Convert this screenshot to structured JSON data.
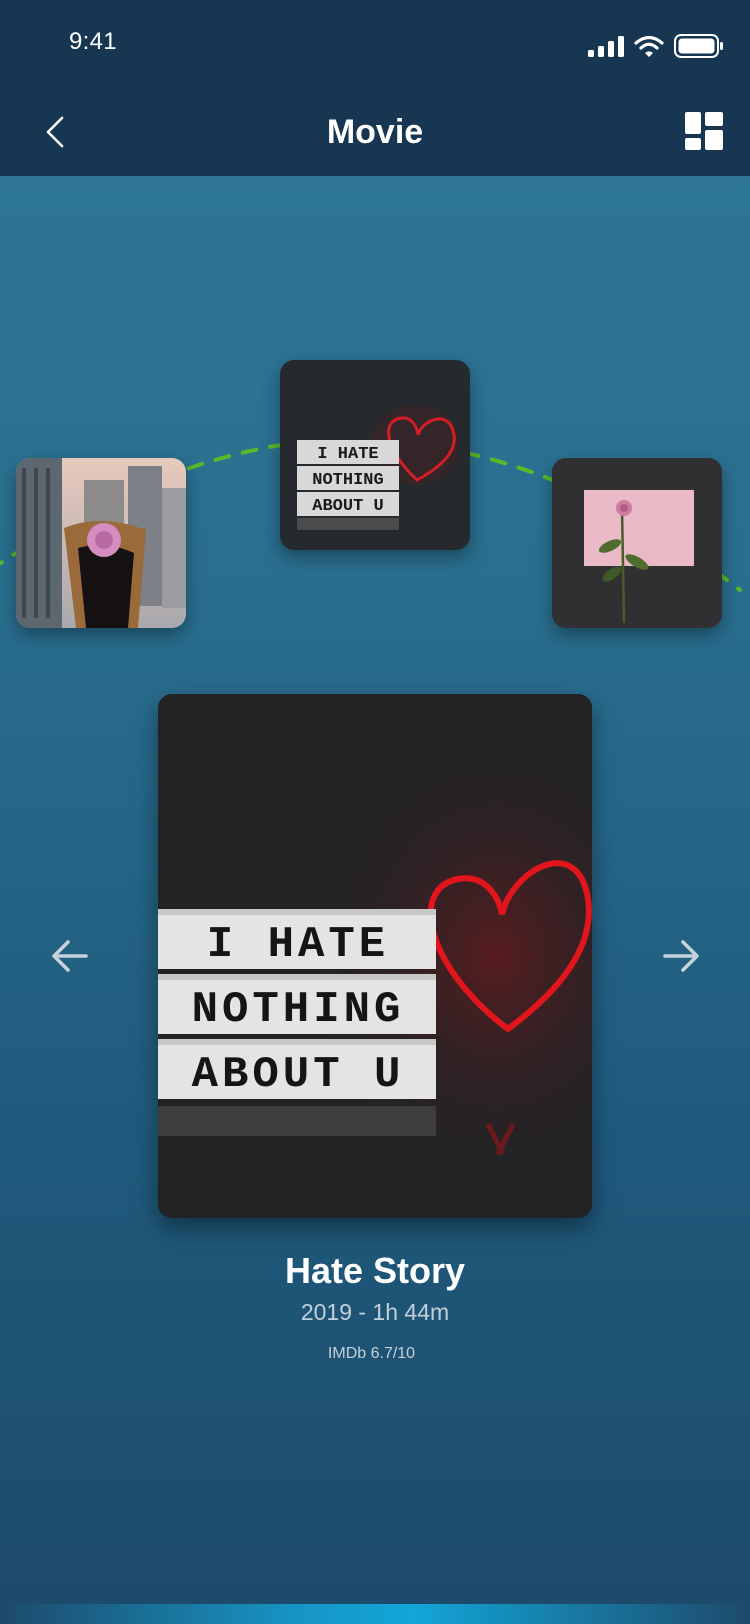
{
  "status_bar": {
    "time": "9:41"
  },
  "header": {
    "title": "Movie"
  },
  "carousel": {
    "items": [
      {
        "name": "rose-bouquet-cityscape"
      },
      {
        "name": "i-hate-nothing-about-u-lightbox",
        "selected": true
      },
      {
        "name": "rose-on-pink-envelope"
      }
    ]
  },
  "poster": {
    "sign_lines": [
      "I HATE",
      "NOTHING",
      "ABOUT U"
    ]
  },
  "movie": {
    "title": "Hate Story",
    "meta": "2019 - 1h 44m",
    "rating": "IMDb 6.7/10"
  },
  "colors": {
    "header_bg": "#173651",
    "accent_dash": "#5bb82b",
    "neon_red": "#e0161c"
  }
}
